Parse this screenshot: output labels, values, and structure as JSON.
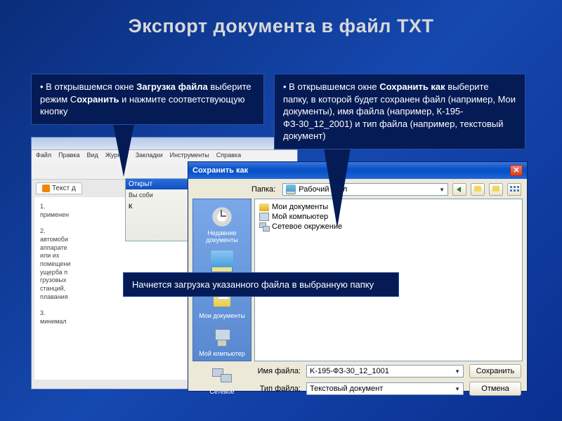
{
  "slide_title": "Экспорт  документа в файл ТХТ",
  "callout_left_html": "• В открывшемся окне <b>Загрузка файла</b> выберите режим С<b>охранить</b> и нажмите соответствующую кнопку",
  "callout_right_html": "• В открывшемся окне  <b>Сохранить как</b> выберите папку, в которой будет сохранен файл (например, Мои документы), имя файла (например, К-195-ФЗ-30_12_2001) и тип файла (например, текстовый документ)",
  "callout_band": "Начнется загрузка указанного файла в выбранную папку",
  "browser": {
    "menu": [
      "Файл",
      "Правка",
      "Вид",
      "Журнал",
      "Закладки",
      "Инструменты",
      "Справка"
    ],
    "tab_label": "Текст д",
    "body_lines": [
      "1.",
      "применен",
      "2.",
      "автомоби",
      "аппарате",
      "или их",
      "помещени",
      "ущерба п",
      "грузовых",
      "станций,",
      "плавания",
      "3.",
      "минимал"
    ]
  },
  "open_fragment": {
    "title": "Открыт",
    "line1": "Вы соби",
    "line2": "К"
  },
  "save_dialog": {
    "title": "Сохранить как",
    "folder_label": "Папка:",
    "folder_value": "Рабочий стол",
    "sidebar": {
      "recent": "Недавние документы",
      "desktop": "Рабочий стол",
      "docs": "Мои документы",
      "computer": "Мой компьютер",
      "network": "Сетевое"
    },
    "file_items": {
      "my_docs": "Мои документы",
      "my_computer": "Мой компьютер",
      "network": "Сетевое окружение"
    },
    "filename_label": "Имя файла:",
    "filename_value": "K-195-ФЗ-30_12_1001",
    "filetype_label": "Тип файла:",
    "filetype_value": "Текстовый документ",
    "save_btn": "Сохранить",
    "cancel_btn": "Отмена"
  }
}
